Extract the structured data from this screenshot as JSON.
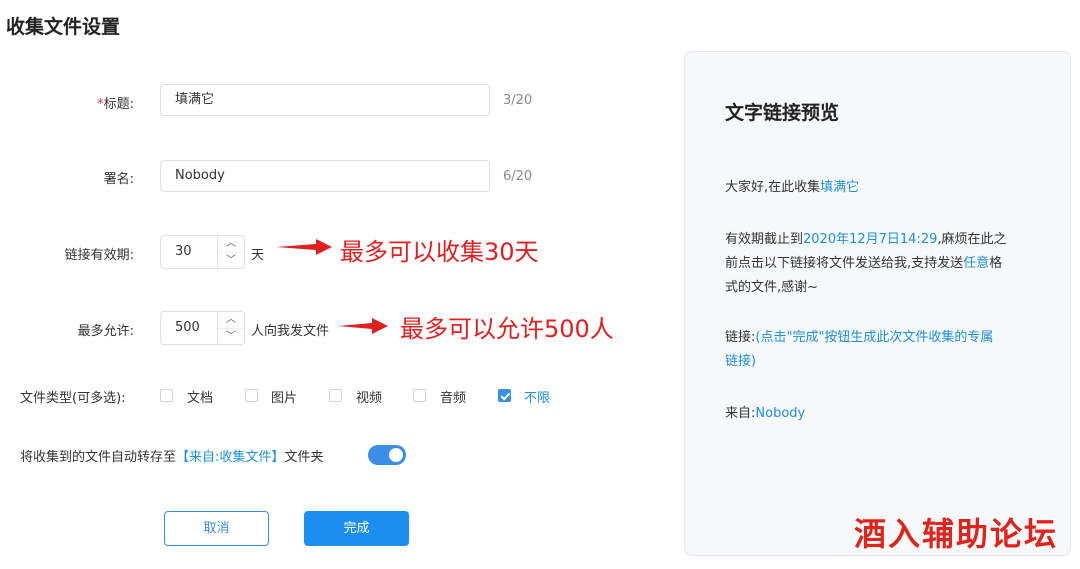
{
  "page": {
    "title": "收集文件设置"
  },
  "form": {
    "title_field": {
      "required_mark": "*",
      "label": "标题:",
      "value": "填满它",
      "counter": "3/20"
    },
    "signature_field": {
      "label": "署名:",
      "value": "Nobody",
      "counter": "6/20"
    },
    "validity_field": {
      "label": "链接有效期:",
      "value": "30",
      "unit": "天",
      "annotation": "最多可以收集30天"
    },
    "max_allowed_field": {
      "label": "最多允许:",
      "value": "500",
      "unit": "人向我发文件",
      "annotation": "最多可以允许500人"
    },
    "file_types": {
      "label": "文件类型(可多选):",
      "options": [
        {
          "label": "文档",
          "checked": false
        },
        {
          "label": "图片",
          "checked": false
        },
        {
          "label": "视频",
          "checked": false
        },
        {
          "label": "音频",
          "checked": false
        },
        {
          "label": "不限",
          "checked": true
        }
      ]
    },
    "auto_save": {
      "prefix": "将收集到的文件自动转存至",
      "bracket_open": "【",
      "folder": "来自:收集文件",
      "bracket_close": "】",
      "suffix": "文件夹",
      "enabled": true
    },
    "buttons": {
      "cancel": "取消",
      "done": "完成"
    }
  },
  "preview": {
    "title": "文字链接预览",
    "greeting_prefix": "大家好,在此收集",
    "greeting_title": "填满它",
    "deadline_prefix": "有效期截止到",
    "deadline_date": "2020年12月7日14:29",
    "deadline_line1_rest": ",麻烦在此之",
    "deadline_line2": "前点击以下链接将文件发送给我,支持发送",
    "deadline_any": "任意",
    "deadline_line2_end": "格",
    "deadline_line3": "式的文件,感谢~",
    "link_label": "链接:",
    "link_text_line1": "(点击\"完成\"按钮生成此次文件收集的专属",
    "link_text_line2": "链接)",
    "from_label": "来自:",
    "from_name": "Nobody"
  },
  "watermark": "酒入辅助论坛",
  "colors": {
    "accent": "#1b8ef0",
    "link": "#1e90d9",
    "annotation": "#e02020"
  }
}
